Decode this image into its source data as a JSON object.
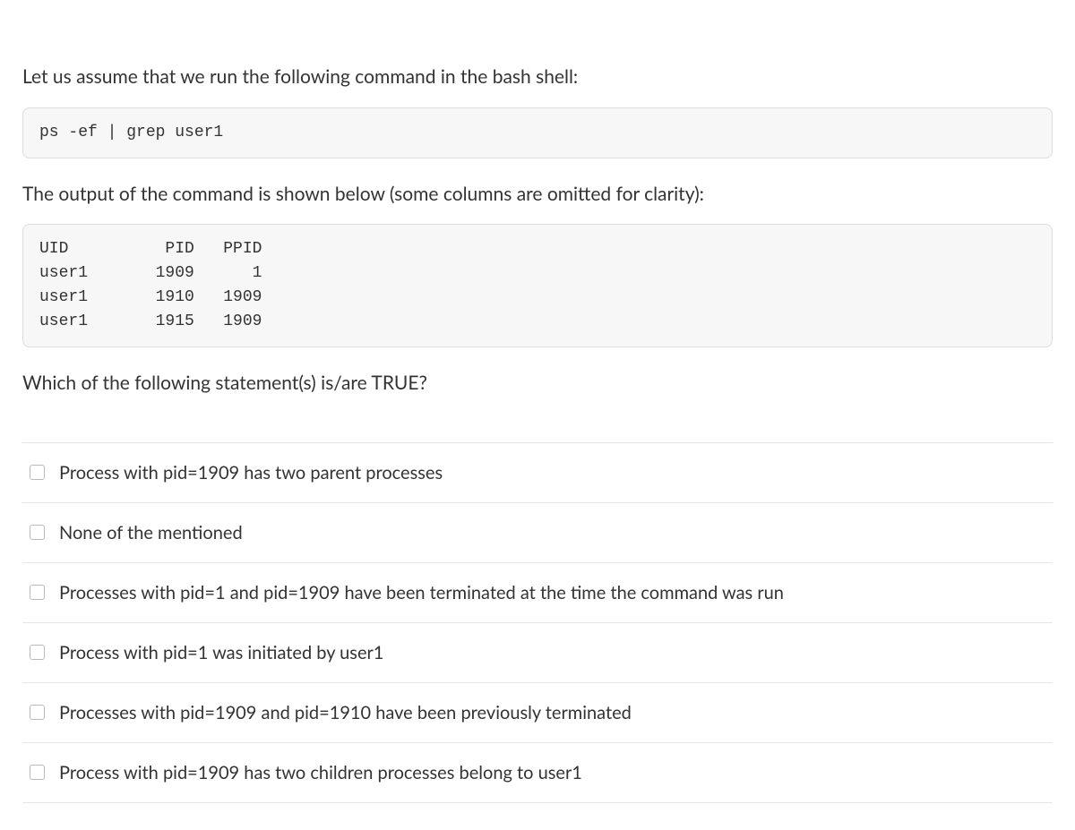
{
  "question": {
    "intro": "Let us assume that we run the following command in the bash shell:",
    "command": "ps -ef | grep user1",
    "output_intro": "The output of the command is shown below (some columns are omitted for clarity):",
    "output_table": "UID          PID   PPID\nuser1       1909      1\nuser1       1910   1909\nuser1       1915   1909",
    "prompt": "Which of the following statement(s) is/are TRUE?"
  },
  "options": [
    {
      "label": "Process with pid=1909 has two parent processes"
    },
    {
      "label": "None of the mentioned"
    },
    {
      "label": "Processes with pid=1 and pid=1909 have been terminated at the time the command was run"
    },
    {
      "label": "Process with pid=1 was initiated by user1"
    },
    {
      "label": "Processes with pid=1909 and pid=1910 have been previously terminated"
    },
    {
      "label": "Process with pid=1909 has two children processes belong to user1"
    }
  ]
}
